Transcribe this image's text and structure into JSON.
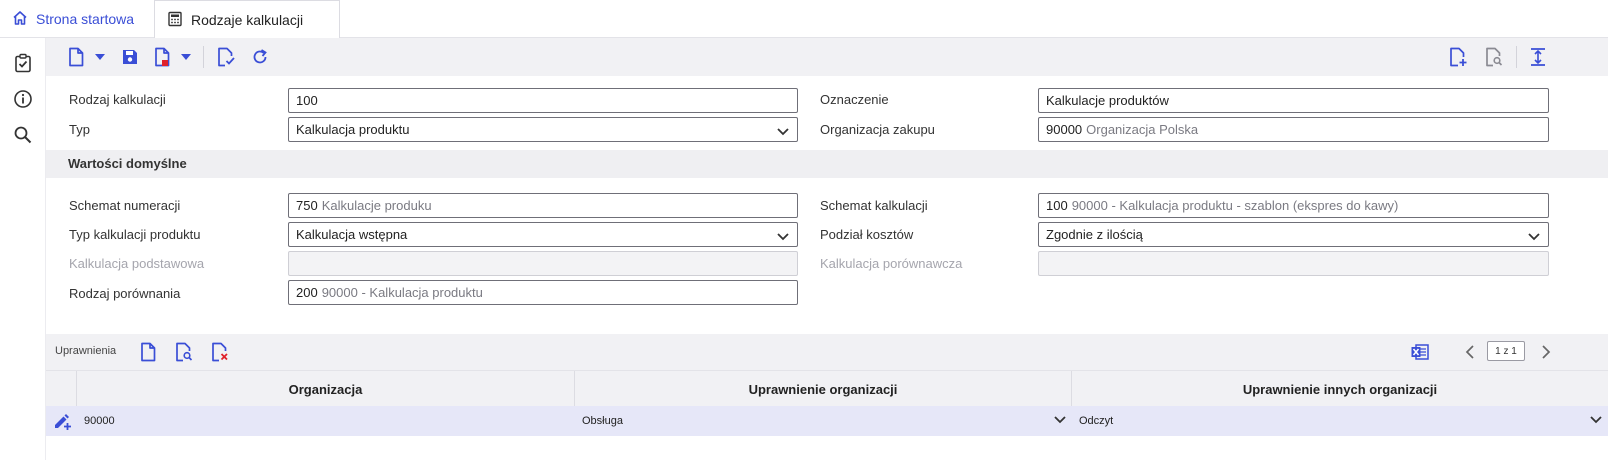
{
  "tabs": {
    "home": {
      "label": "Strona startowa",
      "icon": "home-icon"
    },
    "active": {
      "label": "Rodzaje kalkulacji",
      "icon": "calculator-icon"
    }
  },
  "rail": {
    "icons": [
      "checklist-icon",
      "info-icon",
      "search-icon"
    ]
  },
  "toolbar": {
    "left_icons": [
      "new-document-icon",
      "dropdown-caret-icon",
      "save-icon",
      "delete-document-icon",
      "dropdown-caret-icon",
      "validate-document-icon",
      "refresh-icon"
    ],
    "right_icons": [
      "add-document-icon",
      "preview-document-icon",
      "expand-height-icon"
    ]
  },
  "form": {
    "rodzaj_kalkulacji": {
      "label": "Rodzaj kalkulacji",
      "value": "100"
    },
    "oznaczenie": {
      "label": "Oznaczenie",
      "value": "Kalkulacje produktów"
    },
    "typ": {
      "label": "Typ",
      "value": "Kalkulacja produktu"
    },
    "organizacja_zakupu": {
      "label": "Organizacja zakupu",
      "code": "90000",
      "desc": "Organizacja Polska"
    },
    "section_title": "Wartości domyślne",
    "schemat_numeracji": {
      "label": "Schemat numeracji",
      "code": "750",
      "desc": "Kalkulacje produku"
    },
    "schemat_kalkulacji": {
      "label": "Schemat kalkulacji",
      "code": "100",
      "desc": "90000 - Kalkulacja produktu - szablon (ekspres do kawy)"
    },
    "typ_kalkulacji_produktu": {
      "label": "Typ kalkulacji produktu",
      "value": "Kalkulacja wstępna"
    },
    "podzial_kosztow": {
      "label": "Podział kosztów",
      "value": "Zgodnie z ilością"
    },
    "kalkulacja_podstawowa": {
      "label": "Kalkulacja podstawowa",
      "value": ""
    },
    "kalkulacja_porownawcza": {
      "label": "Kalkulacja porównawcza",
      "value": ""
    },
    "rodzaj_porownania": {
      "label": "Rodzaj porównania",
      "code": "200",
      "desc": "90000 - Kalkulacja produktu"
    }
  },
  "grid": {
    "title": "Uprawnienia",
    "pager": "1 z 1",
    "columns": [
      "Organizacja",
      "Uprawnienie organizacji",
      "Uprawnienie innych organizacji"
    ],
    "rows": [
      {
        "organizacja": "90000",
        "uprawnienie": "Obsługa",
        "uprawnienie_innych": "Odczyt"
      }
    ]
  },
  "colors": {
    "accent": "#3a4ed6",
    "selected_row": "#e6e7f8",
    "toolbar_bg": "#f1f1f4",
    "delete_red": "#e0202a"
  }
}
